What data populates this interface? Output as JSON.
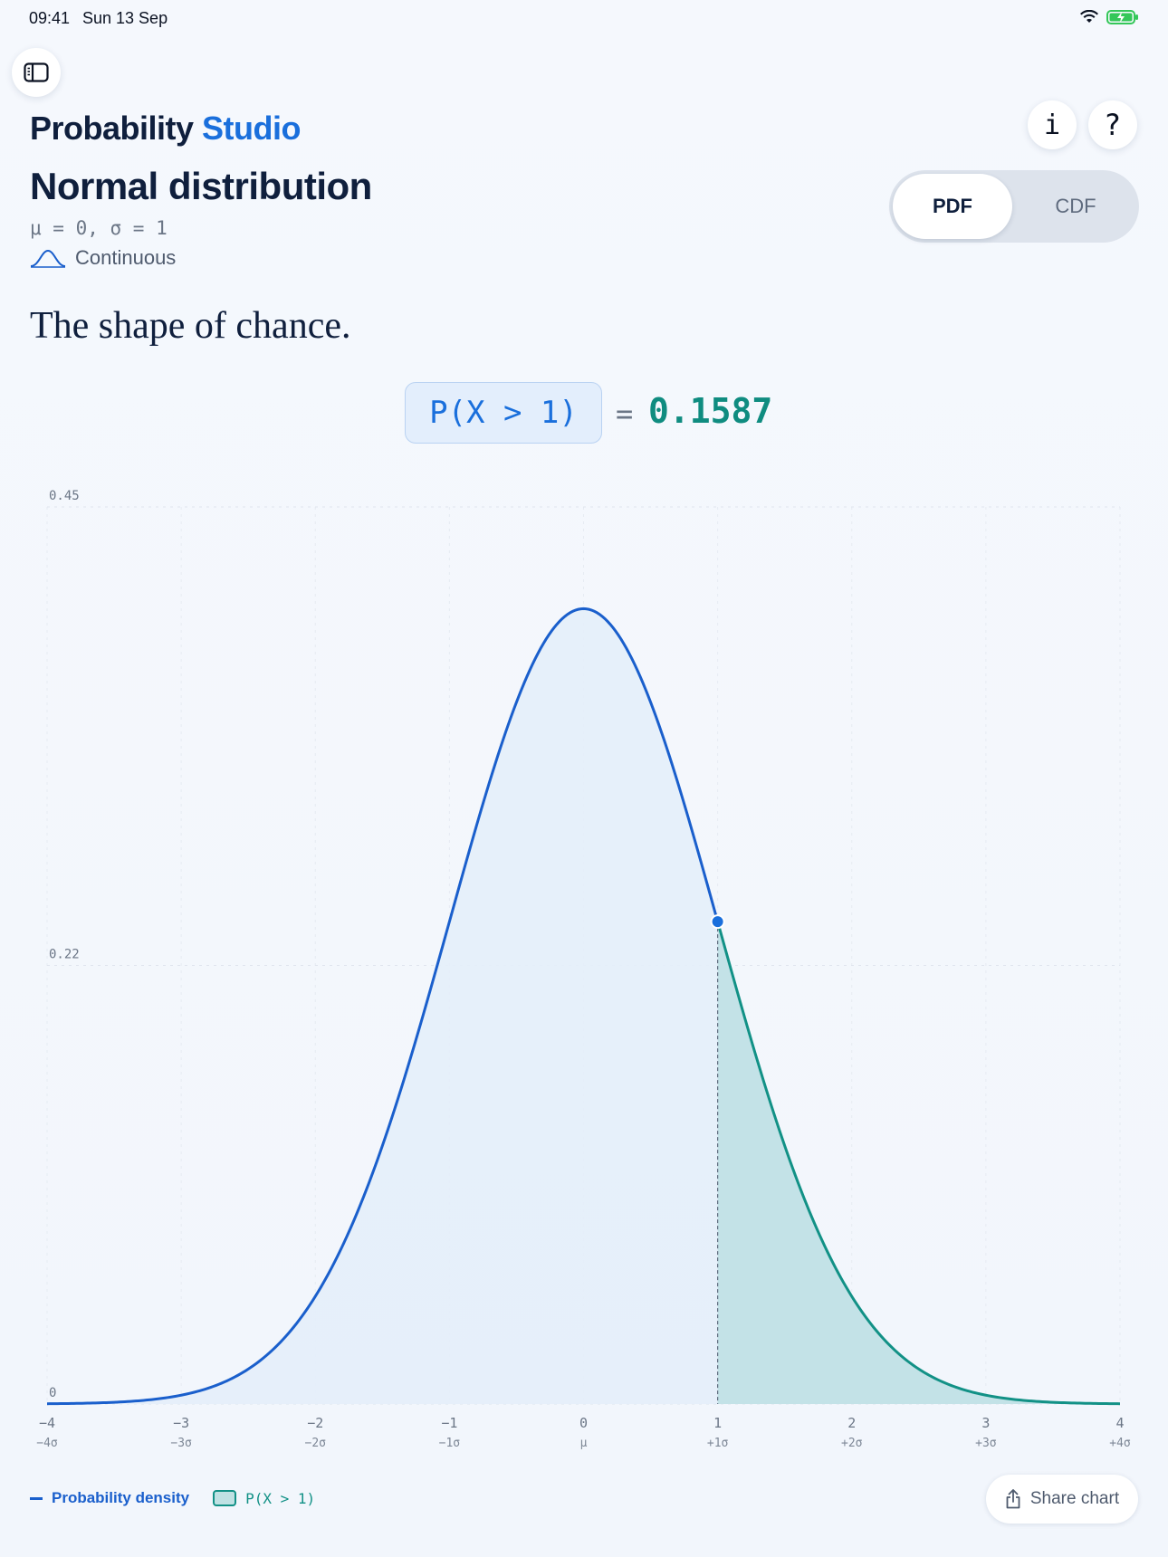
{
  "status": {
    "time": "09:41",
    "date": "Sun 13 Sep"
  },
  "header": {
    "app_title_main": "Probability",
    "app_title_accent": "Studio",
    "distribution_title": "Normal distribution",
    "params": "μ = 0, σ = 1",
    "type_label": "Continuous",
    "info_label": "i",
    "help_label": "?"
  },
  "toggle": {
    "options": [
      "PDF",
      "CDF"
    ],
    "selected": "PDF"
  },
  "tagline": "The shape of chance.",
  "probability": {
    "expression": "P(X > 1)",
    "equals": "=",
    "value": "0.1587"
  },
  "legend": {
    "density_label": "Probability density",
    "shaded_label": "P(X > 1)"
  },
  "share_label": "Share chart",
  "colors": {
    "accent": "#1a6fdc",
    "curve": "#1a5fcc",
    "tail": "#129186",
    "fill": "#e4eefa"
  },
  "chart_data": {
    "type": "area",
    "function": "normal_pdf",
    "mu": 0,
    "sigma": 1,
    "xlim": [
      -4,
      4
    ],
    "ylim": [
      0,
      0.45
    ],
    "x_ticks": [
      {
        "value": -4,
        "label": "−4",
        "sigma": "−4σ"
      },
      {
        "value": -3,
        "label": "−3",
        "sigma": "−3σ"
      },
      {
        "value": -2,
        "label": "−2",
        "sigma": "−2σ"
      },
      {
        "value": -1,
        "label": "−1",
        "sigma": "−1σ"
      },
      {
        "value": 0,
        "label": "0",
        "sigma": "μ"
      },
      {
        "value": 1,
        "label": "1",
        "sigma": "+1σ"
      },
      {
        "value": 2,
        "label": "2",
        "sigma": "+2σ"
      },
      {
        "value": 3,
        "label": "3",
        "sigma": "+3σ"
      },
      {
        "value": 4,
        "label": "4",
        "sigma": "+4σ"
      }
    ],
    "y_ticks": [
      {
        "value": 0.45,
        "label": "0.45"
      },
      {
        "value": 0.22,
        "label": "0.22"
      },
      {
        "value": 0,
        "label": "0"
      }
    ],
    "shaded_region": {
      "from": 1,
      "to": 4,
      "probability": 0.1587
    },
    "marker": {
      "x": 1,
      "y": 0.242
    },
    "grid": true
  }
}
